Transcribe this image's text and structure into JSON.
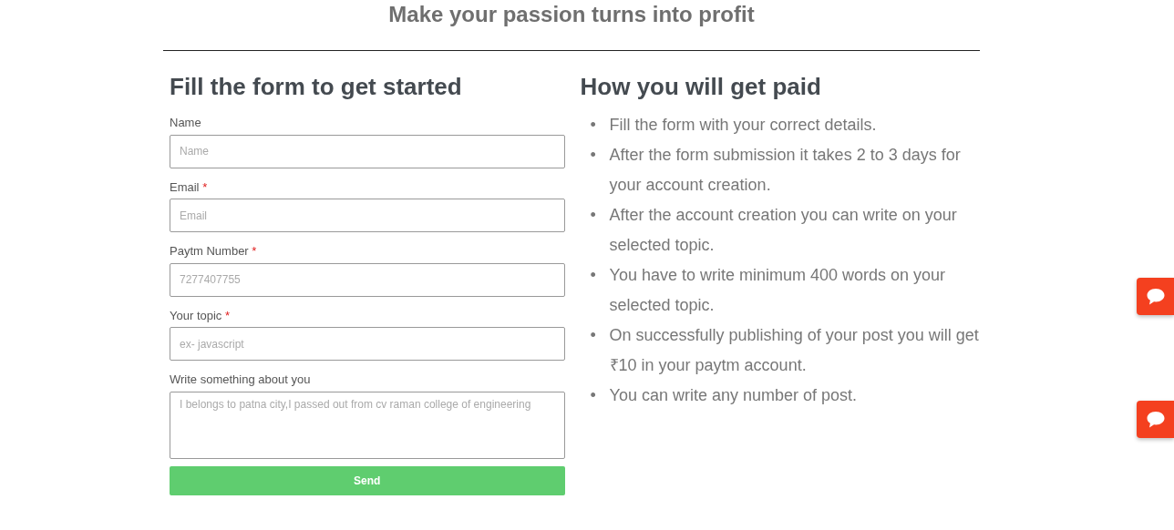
{
  "page_title": "Make your passion turns into profit",
  "form": {
    "heading": "Fill the form to get started",
    "fields": [
      {
        "kind": "input",
        "label": "Name",
        "required": false,
        "placeholder": "Name"
      },
      {
        "kind": "input",
        "label": "Email",
        "required": true,
        "placeholder": "Email"
      },
      {
        "kind": "input",
        "label": "Paytm Number",
        "required": true,
        "placeholder": "7277407755"
      },
      {
        "kind": "input",
        "label": "Your topic",
        "required": true,
        "placeholder": "ex- javascript"
      },
      {
        "kind": "textarea",
        "label": "Write something about you",
        "required": false,
        "placeholder": "I belongs to patna city,I passed out from cv raman college of engineering"
      }
    ],
    "required_mark": "*",
    "submit": "Send"
  },
  "payment": {
    "heading": "How you will get paid",
    "bullet": "•",
    "steps": [
      "Fill the form with your correct details.",
      "After the form submission it takes 2 to 3 days for your account creation.",
      "After the account creation you can write on your selected topic.",
      "You have to write minimum 400 words on your selected topic.",
      "On successfully publishing of your post you will get ₹10 in your paytm account.",
      "You can write any number of post."
    ]
  },
  "chat_buttons": [
    {
      "kind": "chat"
    },
    {
      "kind": "chat"
    }
  ]
}
